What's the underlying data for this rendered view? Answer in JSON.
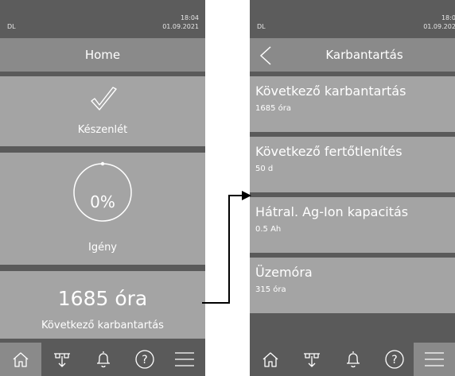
{
  "left": {
    "status": {
      "user": "DL",
      "time": "18:04",
      "date": "01.09.2021"
    },
    "title": "Home",
    "state_label": "Készenlét",
    "demand": {
      "value": "0%",
      "label": "Igény",
      "level_percent": 0
    },
    "maintenance": {
      "value": "1685 óra",
      "label": "Következő karbantartás"
    }
  },
  "right": {
    "status": {
      "user": "DL",
      "time": "18:04",
      "date": "01.09.2021"
    },
    "title": "Karbantartás",
    "items": [
      {
        "title": "Következő karbantartás",
        "value": "1685 óra"
      },
      {
        "title": "Következő fertőtlenítés",
        "value": "50 d"
      },
      {
        "title": "Hátral. Ag-Ion kapacitás",
        "value": "0.5 Ah"
      },
      {
        "title": "Üzemóra",
        "value": "315 óra"
      }
    ]
  },
  "nav_icons": [
    "home-icon",
    "drain-icon",
    "bell-icon",
    "help-icon",
    "menu-icon"
  ],
  "colors": {
    "background": "#5a5a5a",
    "card": "#a4a4a4",
    "titlebar": "#8a8a8a",
    "text": "#ffffff",
    "connector": "#000000"
  }
}
